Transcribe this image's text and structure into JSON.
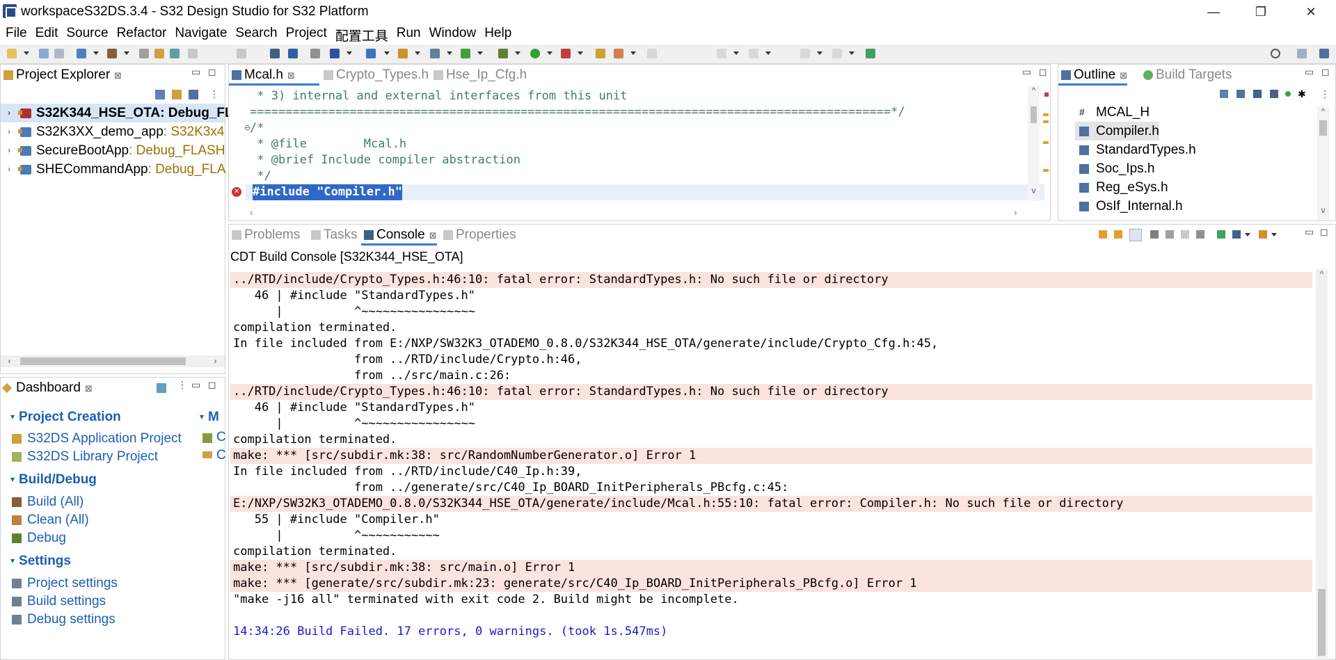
{
  "window": {
    "title": "workspaceS32DS.3.4 - S32 Design Studio for S32 Platform",
    "minimize": "—",
    "restore": "❐",
    "close": "✕"
  },
  "menu": [
    {
      "label": "File",
      "mnemonic": "F"
    },
    {
      "label": "Edit",
      "mnemonic": "E"
    },
    {
      "label": "Source",
      "mnemonic": "S"
    },
    {
      "label": "Refactor",
      "mnemonic": "t"
    },
    {
      "label": "Navigate",
      "mnemonic": "N"
    },
    {
      "label": "Search",
      "mnemonic": "a"
    },
    {
      "label": "Project",
      "mnemonic": "P"
    },
    {
      "label": "配置工具",
      "mnemonic": ""
    },
    {
      "label": "Run",
      "mnemonic": "R"
    },
    {
      "label": "Window",
      "mnemonic": "W"
    },
    {
      "label": "Help",
      "mnemonic": "H"
    }
  ],
  "project_explorer": {
    "tab_label": "Project Explorer",
    "projects": [
      {
        "name": "S32K344_HSE_OTA",
        "config": ": Debug_FL",
        "bold": true,
        "selected": true
      },
      {
        "name": "S32K3XX_demo_app",
        "config": ": S32K3x4",
        "bold": false,
        "selected": false
      },
      {
        "name": "SecureBootApp",
        "config": ": Debug_FLASH",
        "bold": false,
        "selected": false
      },
      {
        "name": "SHECommandApp",
        "config": ": Debug_FLA",
        "bold": false,
        "selected": false
      }
    ]
  },
  "dashboard": {
    "tab_label": "Dashboard",
    "sections": [
      {
        "title": "Project Creation",
        "items": [
          "S32DS Application Project",
          "S32DS Library Project"
        ]
      },
      {
        "title": "Build/Debug",
        "items": [
          "Build  (All)",
          "Clean  (All)",
          "Debug"
        ]
      },
      {
        "title": "Settings",
        "items": [
          "Project settings",
          "Build settings",
          "Debug settings"
        ]
      }
    ],
    "right_section_partial": "M",
    "right_items_partial": [
      "C",
      "C"
    ]
  },
  "editor": {
    "tabs": [
      {
        "label": "Mcal.h",
        "active": true
      },
      {
        "label": "Crypto_Types.h",
        "active": false
      },
      {
        "label": "Hse_Ip_Cfg.h",
        "active": false
      }
    ],
    "lines": [
      " * 3) internal and external interfaces from this unit",
      "==========================================================================================*/",
      "/*",
      " * @file        Mcal.h",
      " * @brief Include compiler abstraction",
      " */",
      "#include \"Compiler.h\""
    ]
  },
  "outline": {
    "tabs": [
      {
        "label": "Outline",
        "active": true
      },
      {
        "label": "Build Targets",
        "active": false
      }
    ],
    "items": [
      {
        "label": "MCAL_H",
        "icon": "hash-icon"
      },
      {
        "label": "Compiler.h",
        "icon": "include-icon"
      },
      {
        "label": "StandardTypes.h",
        "icon": "include-icon"
      },
      {
        "label": "Soc_Ips.h",
        "icon": "include-icon"
      },
      {
        "label": "Reg_eSys.h",
        "icon": "include-icon"
      },
      {
        "label": "OsIf_Internal.h",
        "icon": "include-icon"
      }
    ]
  },
  "bottom": {
    "tabs": [
      {
        "label": "Problems",
        "active": false
      },
      {
        "label": "Tasks",
        "active": false
      },
      {
        "label": "Console",
        "active": true
      },
      {
        "label": "Properties",
        "active": false
      }
    ],
    "console_title": "CDT Build Console [S32K344_HSE_OTA]",
    "lines": [
      {
        "text": "../RTD/include/Crypto_Types.h:46:10: fatal error: StandardTypes.h: No such file or directory",
        "kind": "err"
      },
      {
        "text": "   46 | #include \"StandardTypes.h\"",
        "kind": "normal"
      },
      {
        "text": "      |          ^~~~~~~~~~~~~~~~~",
        "kind": "normal"
      },
      {
        "text": "compilation terminated.",
        "kind": "normal"
      },
      {
        "text": "In file included from E:/NXP/SW32K3_OTADEMO_0.8.0/S32K344_HSE_OTA/generate/include/Crypto_Cfg.h:45,",
        "kind": "normal"
      },
      {
        "text": "                 from ../RTD/include/Crypto.h:46,",
        "kind": "normal"
      },
      {
        "text": "                 from ../src/main.c:26:",
        "kind": "normal"
      },
      {
        "text": "../RTD/include/Crypto_Types.h:46:10: fatal error: StandardTypes.h: No such file or directory",
        "kind": "err"
      },
      {
        "text": "   46 | #include \"StandardTypes.h\"",
        "kind": "normal"
      },
      {
        "text": "      |          ^~~~~~~~~~~~~~~~~",
        "kind": "normal"
      },
      {
        "text": "compilation terminated.",
        "kind": "normal"
      },
      {
        "text": "make: *** [src/subdir.mk:38: src/RandomNumberGenerator.o] Error 1",
        "kind": "err"
      },
      {
        "text": "In file included from ../RTD/include/C40_Ip.h:39,",
        "kind": "normal"
      },
      {
        "text": "                 from ../generate/src/C40_Ip_BOARD_InitPeripherals_PBcfg.c:45:",
        "kind": "normal"
      },
      {
        "text": "E:/NXP/SW32K3_OTADEMO_0.8.0/S32K344_HSE_OTA/generate/include/Mcal.h:55:10: fatal error: Compiler.h: No such file or directory",
        "kind": "err"
      },
      {
        "text": "   55 | #include \"Compiler.h\"",
        "kind": "normal"
      },
      {
        "text": "      |          ^~~~~~~~~~~~",
        "kind": "normal"
      },
      {
        "text": "compilation terminated.",
        "kind": "normal"
      },
      {
        "text": "make: *** [src/subdir.mk:38: src/main.o] Error 1",
        "kind": "err"
      },
      {
        "text": "make: *** [generate/src/subdir.mk:23: generate/src/C40_Ip_BOARD_InitPeripherals_PBcfg.o] Error 1",
        "kind": "err"
      },
      {
        "text": "\"make -j16 all\" terminated with exit code 2. Build might be incomplete.",
        "kind": "normal"
      },
      {
        "text": "",
        "kind": "normal"
      },
      {
        "text": "14:34:26 Build Failed. 17 errors, 0 warnings. (took 1s.547ms)",
        "kind": "blue"
      }
    ]
  },
  "colors": {
    "error_bg": "#fbe3de",
    "link_blue": "#1a5fb4",
    "selection": "#d7e6f7"
  }
}
